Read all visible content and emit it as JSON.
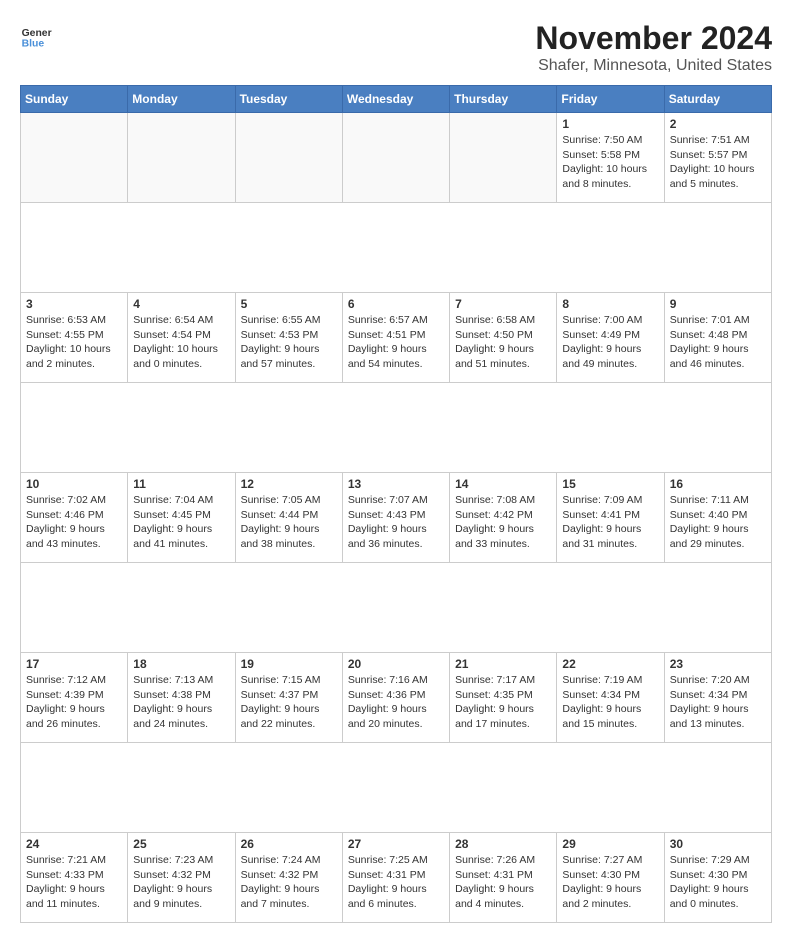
{
  "header": {
    "logo_line1": "General",
    "logo_line2": "Blue",
    "title": "November 2024",
    "subtitle": "Shafer, Minnesota, United States"
  },
  "weekdays": [
    "Sunday",
    "Monday",
    "Tuesday",
    "Wednesday",
    "Thursday",
    "Friday",
    "Saturday"
  ],
  "weeks": [
    [
      {
        "date": "",
        "info": ""
      },
      {
        "date": "",
        "info": ""
      },
      {
        "date": "",
        "info": ""
      },
      {
        "date": "",
        "info": ""
      },
      {
        "date": "",
        "info": ""
      },
      {
        "date": "1",
        "info": "Sunrise: 7:50 AM\nSunset: 5:58 PM\nDaylight: 10 hours and 8 minutes."
      },
      {
        "date": "2",
        "info": "Sunrise: 7:51 AM\nSunset: 5:57 PM\nDaylight: 10 hours and 5 minutes."
      }
    ],
    [
      {
        "date": "3",
        "info": "Sunrise: 6:53 AM\nSunset: 4:55 PM\nDaylight: 10 hours and 2 minutes."
      },
      {
        "date": "4",
        "info": "Sunrise: 6:54 AM\nSunset: 4:54 PM\nDaylight: 10 hours and 0 minutes."
      },
      {
        "date": "5",
        "info": "Sunrise: 6:55 AM\nSunset: 4:53 PM\nDaylight: 9 hours and 57 minutes."
      },
      {
        "date": "6",
        "info": "Sunrise: 6:57 AM\nSunset: 4:51 PM\nDaylight: 9 hours and 54 minutes."
      },
      {
        "date": "7",
        "info": "Sunrise: 6:58 AM\nSunset: 4:50 PM\nDaylight: 9 hours and 51 minutes."
      },
      {
        "date": "8",
        "info": "Sunrise: 7:00 AM\nSunset: 4:49 PM\nDaylight: 9 hours and 49 minutes."
      },
      {
        "date": "9",
        "info": "Sunrise: 7:01 AM\nSunset: 4:48 PM\nDaylight: 9 hours and 46 minutes."
      }
    ],
    [
      {
        "date": "10",
        "info": "Sunrise: 7:02 AM\nSunset: 4:46 PM\nDaylight: 9 hours and 43 minutes."
      },
      {
        "date": "11",
        "info": "Sunrise: 7:04 AM\nSunset: 4:45 PM\nDaylight: 9 hours and 41 minutes."
      },
      {
        "date": "12",
        "info": "Sunrise: 7:05 AM\nSunset: 4:44 PM\nDaylight: 9 hours and 38 minutes."
      },
      {
        "date": "13",
        "info": "Sunrise: 7:07 AM\nSunset: 4:43 PM\nDaylight: 9 hours and 36 minutes."
      },
      {
        "date": "14",
        "info": "Sunrise: 7:08 AM\nSunset: 4:42 PM\nDaylight: 9 hours and 33 minutes."
      },
      {
        "date": "15",
        "info": "Sunrise: 7:09 AM\nSunset: 4:41 PM\nDaylight: 9 hours and 31 minutes."
      },
      {
        "date": "16",
        "info": "Sunrise: 7:11 AM\nSunset: 4:40 PM\nDaylight: 9 hours and 29 minutes."
      }
    ],
    [
      {
        "date": "17",
        "info": "Sunrise: 7:12 AM\nSunset: 4:39 PM\nDaylight: 9 hours and 26 minutes."
      },
      {
        "date": "18",
        "info": "Sunrise: 7:13 AM\nSunset: 4:38 PM\nDaylight: 9 hours and 24 minutes."
      },
      {
        "date": "19",
        "info": "Sunrise: 7:15 AM\nSunset: 4:37 PM\nDaylight: 9 hours and 22 minutes."
      },
      {
        "date": "20",
        "info": "Sunrise: 7:16 AM\nSunset: 4:36 PM\nDaylight: 9 hours and 20 minutes."
      },
      {
        "date": "21",
        "info": "Sunrise: 7:17 AM\nSunset: 4:35 PM\nDaylight: 9 hours and 17 minutes."
      },
      {
        "date": "22",
        "info": "Sunrise: 7:19 AM\nSunset: 4:34 PM\nDaylight: 9 hours and 15 minutes."
      },
      {
        "date": "23",
        "info": "Sunrise: 7:20 AM\nSunset: 4:34 PM\nDaylight: 9 hours and 13 minutes."
      }
    ],
    [
      {
        "date": "24",
        "info": "Sunrise: 7:21 AM\nSunset: 4:33 PM\nDaylight: 9 hours and 11 minutes."
      },
      {
        "date": "25",
        "info": "Sunrise: 7:23 AM\nSunset: 4:32 PM\nDaylight: 9 hours and 9 minutes."
      },
      {
        "date": "26",
        "info": "Sunrise: 7:24 AM\nSunset: 4:32 PM\nDaylight: 9 hours and 7 minutes."
      },
      {
        "date": "27",
        "info": "Sunrise: 7:25 AM\nSunset: 4:31 PM\nDaylight: 9 hours and 6 minutes."
      },
      {
        "date": "28",
        "info": "Sunrise: 7:26 AM\nSunset: 4:31 PM\nDaylight: 9 hours and 4 minutes."
      },
      {
        "date": "29",
        "info": "Sunrise: 7:27 AM\nSunset: 4:30 PM\nDaylight: 9 hours and 2 minutes."
      },
      {
        "date": "30",
        "info": "Sunrise: 7:29 AM\nSunset: 4:30 PM\nDaylight: 9 hours and 0 minutes."
      }
    ]
  ]
}
